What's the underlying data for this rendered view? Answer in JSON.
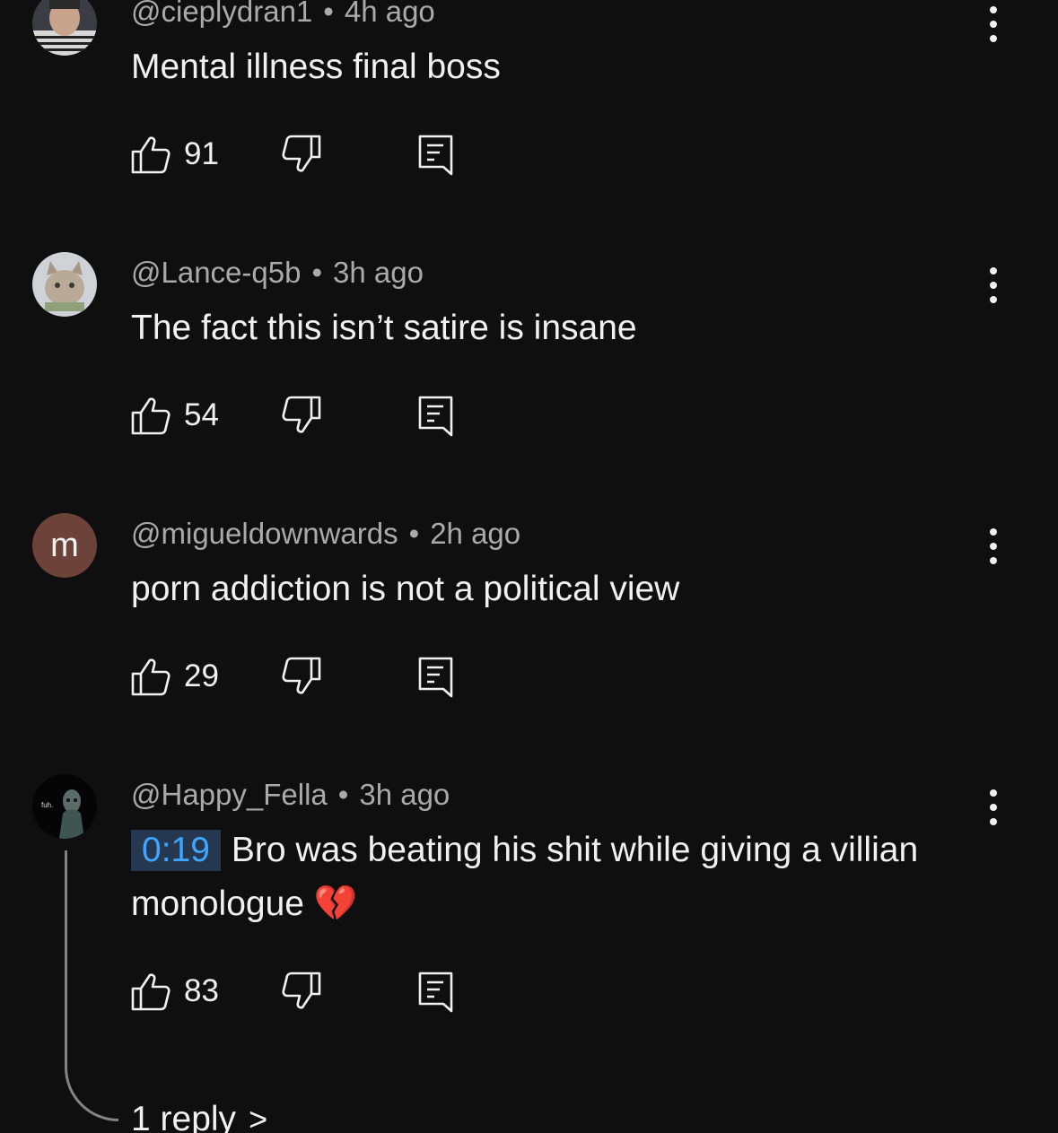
{
  "comments": [
    {
      "author": "@cieplydran1",
      "time": "4h ago",
      "text": "Mental illness final boss",
      "likes": "91",
      "avatar": "photo-avatar"
    },
    {
      "author": "@Lance-q5b",
      "time": "3h ago",
      "text": "The fact this isn’t satire is insane",
      "likes": "54",
      "avatar": "cat-photo-avatar"
    },
    {
      "author": "@migueldownwards",
      "time": "2h ago",
      "text": "porn addiction is not a political view",
      "likes": "29",
      "avatar_letter": "m",
      "avatar_color": "#6d4238"
    },
    {
      "author": "@Happy_Fella",
      "time": "3h ago",
      "timestamp": "0:19",
      "text": "Bro was beating his shit while giving a villian monologue",
      "emoji": "💔",
      "likes": "83",
      "avatar": "dark-figure-avatar",
      "avatar_caption": "fuh.",
      "replies_label": "1 reply"
    }
  ],
  "separator": "•",
  "colors": {
    "background": "#0f0f0f",
    "primary_text": "#f1f1f1",
    "secondary_text": "#aaaaaa",
    "timestamp_text": "#3ea6ff",
    "timestamp_bg": "#263850"
  }
}
